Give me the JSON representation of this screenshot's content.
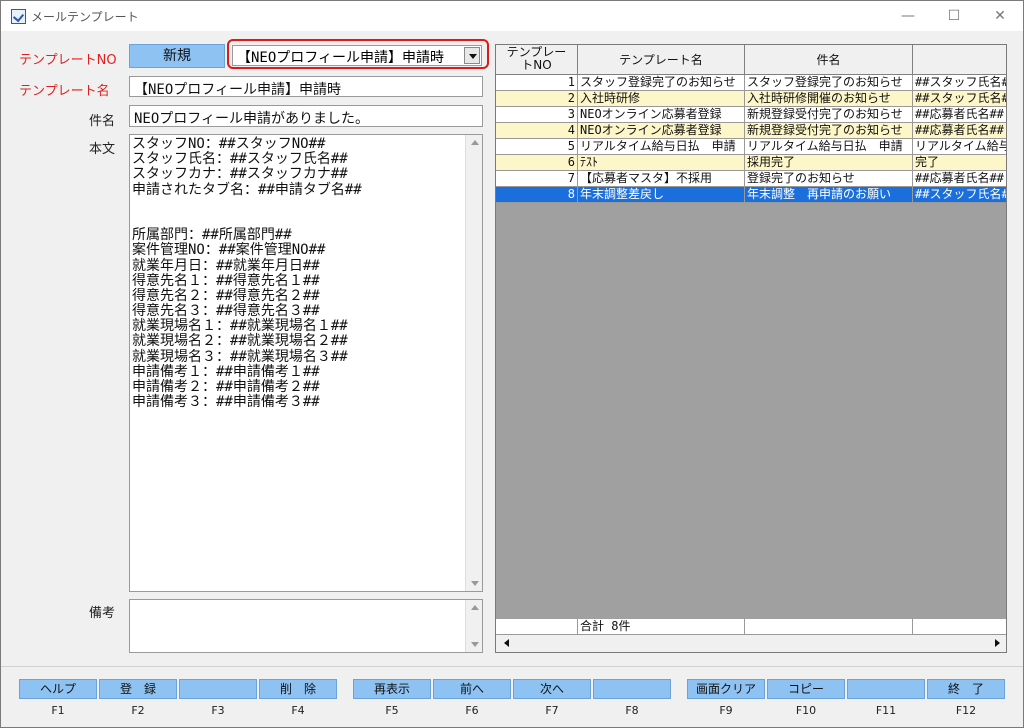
{
  "window": {
    "title": "メールテンプレート"
  },
  "form": {
    "template_no_label": "テンプレートNO",
    "new_button": "新規",
    "template_select": "【NEOプロフィール申請】申請時",
    "template_name_label": "テンプレート名",
    "template_name": "【NEOプロフィール申請】申請時",
    "subject_label": "件名",
    "subject": "NEOプロフィール申請がありました。",
    "body_label": "本文",
    "body_lines": [
      "スタッフNO：##スタッフNO##",
      "スタッフ氏名：##スタッフ氏名##",
      "スタッフカナ：##スタッフカナ##",
      "申請されたタブ名：##申請タブ名##",
      "",
      "",
      "所属部門：##所属部門##",
      "案件管理NO：##案件管理NO##",
      "就業年月日：##就業年月日##",
      "得意先名１：##得意先名１##",
      "得意先名２：##得意先名２##",
      "得意先名３：##得意先名３##",
      "就業現場名１：##就業現場名１##",
      "就業現場名２：##就業現場名２##",
      "就業現場名３：##就業現場名３##",
      "申請備考１：##申請備考１##",
      "申請備考２：##申請備考２##",
      "申請備考３：##申請備考３##"
    ],
    "note_label": "備考",
    "note": ""
  },
  "grid": {
    "headers": [
      "テンプレートNO",
      "テンプレート名",
      "件名",
      ""
    ],
    "header_no_line1": "テンプレー",
    "header_no_line2": "トNO",
    "rows": [
      {
        "no": "1",
        "name": "スタッフ登録完了のお知らせ",
        "subject": "スタッフ登録完了のお知らせ",
        "body": "##スタッフ氏名##",
        "bg": "#ffffff"
      },
      {
        "no": "2",
        "name": "入社時研修",
        "subject": "入社時研修開催のお知らせ",
        "body": "##スタッフ氏名##",
        "bg": "#fdf6c8"
      },
      {
        "no": "3",
        "name": "NEOオンライン応募者登録",
        "subject": "新規登録受付完了のお知らせ",
        "body": "##応募者氏名##",
        "bg": "#ffffff"
      },
      {
        "no": "4",
        "name": "NEOオンライン応募者登録",
        "subject": "新規登録受付完了のお知らせ",
        "body": "##応募者氏名##",
        "bg": "#fdf6c8"
      },
      {
        "no": "5",
        "name": "リアルタイム給与日払　申請",
        "subject": "リアルタイム給与日払　申請",
        "body": "リアルタイム給与",
        "bg": "#ffffff"
      },
      {
        "no": "6",
        "name": "ﾃｽﾄ",
        "subject": "採用完了",
        "body": "完了",
        "bg": "#fdf6c8"
      },
      {
        "no": "7",
        "name": "【応募者マスタ】不採用",
        "subject": "登録完了のお知らせ",
        "body": "##応募者氏名##",
        "bg": "#ffffff"
      },
      {
        "no": "8",
        "name": "年末調整差戻し",
        "subject": "年末調整　再申請のお願い",
        "body": "##スタッフ氏名##",
        "bg": "#1a6fdc",
        "selected": true
      }
    ],
    "total_label": "合計 8件"
  },
  "fkeys": [
    {
      "label": "ヘルプ",
      "key": "F1"
    },
    {
      "label": "登　録",
      "key": "F2"
    },
    {
      "label": "",
      "key": "F3"
    },
    {
      "label": "削　除",
      "key": "F4"
    },
    {
      "label": "再表示",
      "key": "F5"
    },
    {
      "label": "前へ",
      "key": "F6"
    },
    {
      "label": "次へ",
      "key": "F7"
    },
    {
      "label": "",
      "key": "F8"
    },
    {
      "label": "画面クリア",
      "key": "F9"
    },
    {
      "label": "コピー",
      "key": "F10"
    },
    {
      "label": "",
      "key": "F11"
    },
    {
      "label": "終　了",
      "key": "F12"
    }
  ],
  "colors": {
    "accent": "#8dc2f3",
    "required_label": "#e02020",
    "selection": "#1a6fdc",
    "alt_row": "#fdf6c8",
    "highlight": "#e01818"
  }
}
